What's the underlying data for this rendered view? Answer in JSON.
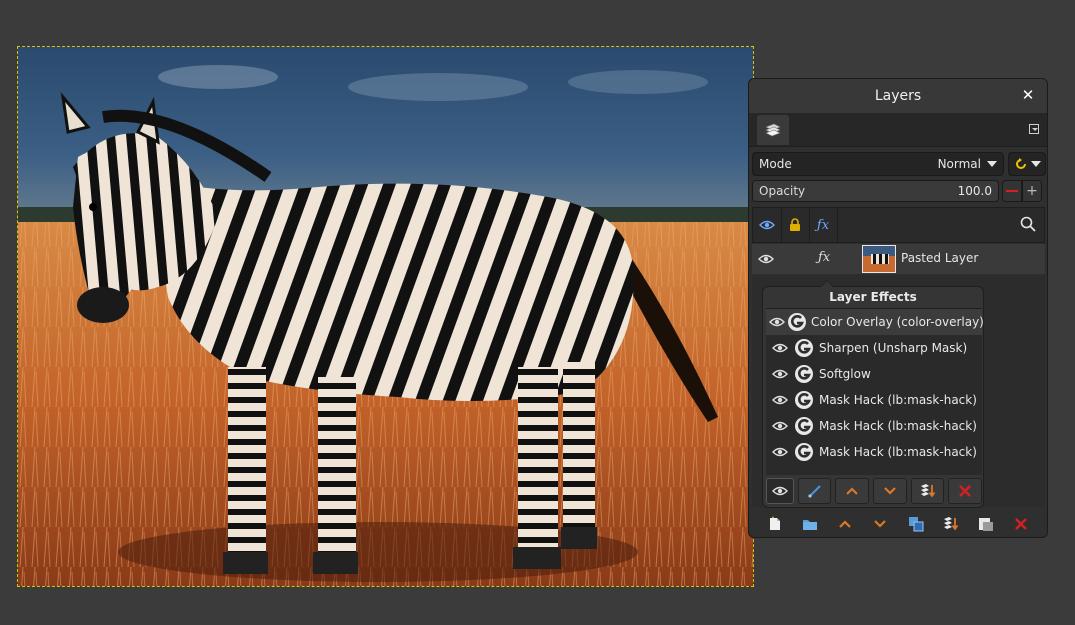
{
  "canvas": {
    "image_desc_icon": "zebra-photo-canvas"
  },
  "dock": {
    "title": "Layers",
    "close_icon": "close-icon",
    "mode": {
      "label": "Mode",
      "value": "Normal"
    },
    "opacity": {
      "label": "Opacity",
      "value": "100.0"
    },
    "layers": [
      {
        "name": "Pasted Layer",
        "visible": true,
        "has_effects": true
      }
    ]
  },
  "layer_effects": {
    "title": "Layer Effects",
    "items": [
      {
        "name": "Color Overlay (color-overlay)",
        "selected": true
      },
      {
        "name": "Sharpen (Unsharp Mask)",
        "selected": false
      },
      {
        "name": "Softglow",
        "selected": false
      },
      {
        "name": "Mask Hack (lb:mask-hack)",
        "selected": false
      },
      {
        "name": "Mask Hack (lb:mask-hack)",
        "selected": false
      },
      {
        "name": "Mask Hack (lb:mask-hack)",
        "selected": false
      }
    ]
  },
  "colors": {
    "accent_orange": "#d9782a",
    "delete_red": "#d42020",
    "blue_icon": "#4a90d9"
  }
}
